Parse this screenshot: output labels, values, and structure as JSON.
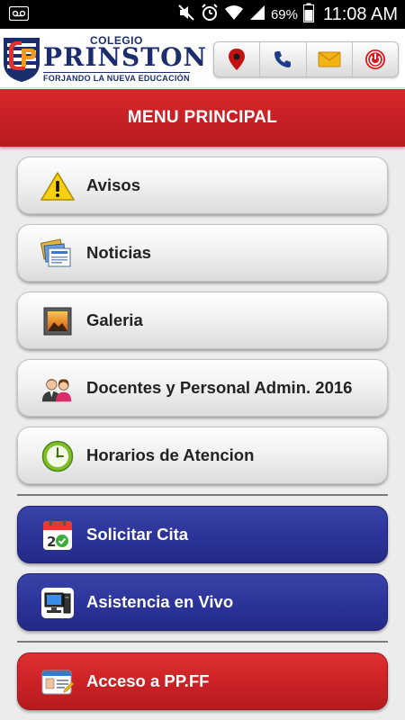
{
  "status_bar": {
    "battery": "69%",
    "time": "11:08 AM"
  },
  "brand": {
    "prefix": "COLEGIO",
    "name": "PRINSTON",
    "slogan": "FORJANDO LA NUEVA EDUCACIÓN"
  },
  "actions": [
    {
      "icon": "location-pin-icon"
    },
    {
      "icon": "phone-icon"
    },
    {
      "icon": "mail-icon"
    },
    {
      "icon": "power-icon"
    }
  ],
  "menu": {
    "title": "MENU PRINCIPAL",
    "items": [
      {
        "label": "Avisos",
        "icon": "warning-icon",
        "style": "gray"
      },
      {
        "label": "Noticias",
        "icon": "news-icon",
        "style": "gray"
      },
      {
        "label": "Galeria",
        "icon": "picture-icon",
        "style": "gray"
      },
      {
        "label": "Docentes y Personal Admin. 2016",
        "icon": "people-icon",
        "style": "gray"
      },
      {
        "label": "Horarios de Atencion",
        "icon": "clock-icon",
        "style": "gray"
      },
      {
        "label": "Solicitar Cita",
        "icon": "calendar-icon",
        "style": "blue"
      },
      {
        "label": "Asistencia en Vivo",
        "icon": "computer-icon",
        "style": "blue"
      },
      {
        "label": "Acceso a PP.FF",
        "icon": "id-card-icon",
        "style": "red"
      }
    ]
  },
  "colors": {
    "header_red": "#c82126",
    "button_blue": "#2c349a",
    "button_red": "#cc2226",
    "brand_navy": "#1c2d6e"
  }
}
